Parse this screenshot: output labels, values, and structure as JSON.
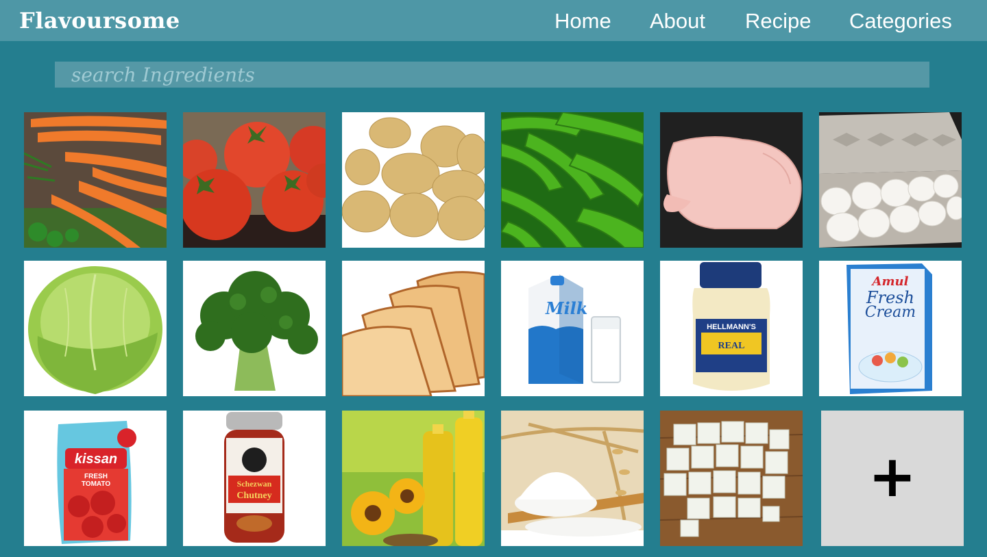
{
  "brand": "Flavoursome",
  "nav": {
    "home": "Home",
    "about": "About",
    "recipe": "Recipe",
    "categories": "Categories"
  },
  "search": {
    "placeholder": "search Ingredients",
    "value": ""
  },
  "tiles": {
    "carrots": "",
    "tomatoes": "",
    "potatoes": "",
    "green_chillies": "",
    "chicken": "",
    "eggs": "",
    "cabbage": "",
    "broccoli": "",
    "bread": "",
    "milk": "Milk",
    "mayonnaise": {
      "brand": "HELLMANN'S",
      "product": "REAL"
    },
    "cream": {
      "brand": "Amul",
      "line1": "Fresh",
      "line2": "Cream"
    },
    "ketchup": {
      "brand": "kissan",
      "line1": "FRESH",
      "line2": "TOMATO"
    },
    "chutney": {
      "line1": "Schezwan",
      "line2": "Chutney"
    },
    "oil": "",
    "flour": "",
    "paneer": ""
  },
  "add_button": {
    "symbol": "+"
  }
}
